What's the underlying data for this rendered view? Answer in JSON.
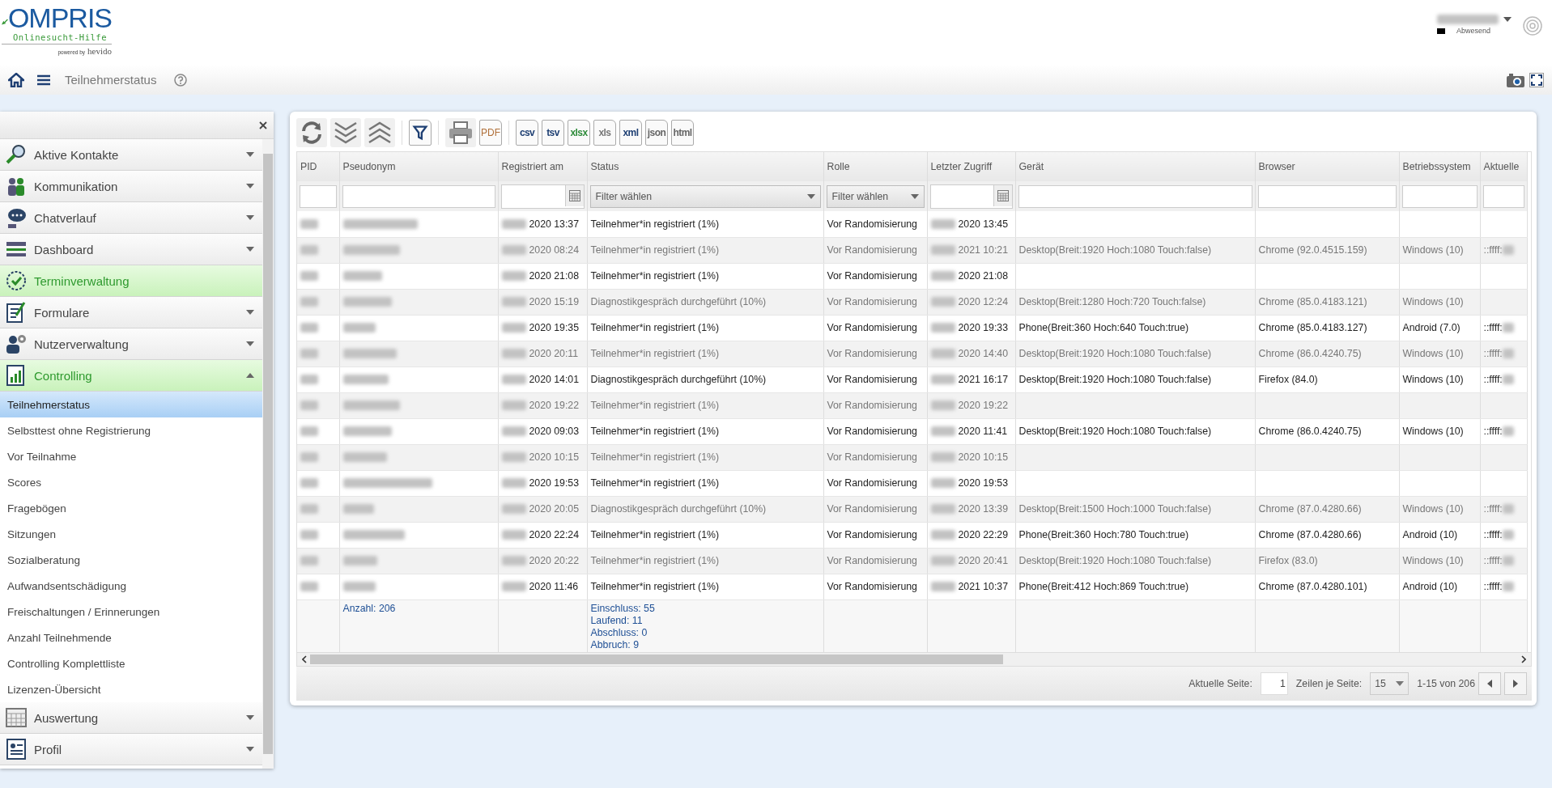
{
  "header": {
    "logo": {
      "title": "OMPRIS",
      "subtitle": "Onlinesucht-Hilfe",
      "powered": "powered by",
      "brand": "hevido"
    },
    "user": {
      "status": "Abwesend"
    }
  },
  "breadcrumb": {
    "title": "Teilnehmerstatus"
  },
  "sidebar": {
    "items": [
      {
        "label": "Aktive Kontakte",
        "kind": "contacts",
        "highlighted": false,
        "expanded": false
      },
      {
        "label": "Kommunikation",
        "kind": "people",
        "highlighted": false,
        "expanded": false
      },
      {
        "label": "Chatverlauf",
        "kind": "chat",
        "highlighted": false,
        "expanded": false
      },
      {
        "label": "Dashboard",
        "kind": "dashboard",
        "highlighted": false,
        "expanded": false
      },
      {
        "label": "Terminverwaltung",
        "kind": "calendar",
        "highlighted": true
      },
      {
        "label": "Formulare",
        "kind": "forms",
        "highlighted": false,
        "expanded": false
      },
      {
        "label": "Nutzerverwaltung",
        "kind": "users",
        "highlighted": false,
        "expanded": false
      },
      {
        "label": "Controlling",
        "kind": "controlling",
        "highlighted": true,
        "expanded": true,
        "children": [
          {
            "label": "Teilnehmerstatus",
            "selected": true
          },
          {
            "label": "Selbsttest ohne Registrierung",
            "selected": false
          },
          {
            "label": "Vor Teilnahme",
            "selected": false
          },
          {
            "label": "Scores",
            "selected": false
          },
          {
            "label": "Fragebögen",
            "selected": false
          },
          {
            "label": "Sitzungen",
            "selected": false
          },
          {
            "label": "Sozialberatung",
            "selected": false
          },
          {
            "label": "Aufwandsentschädigung",
            "selected": false
          },
          {
            "label": "Freischaltungen / Erinnerungen",
            "selected": false
          },
          {
            "label": "Anzahl Teilnehmende",
            "selected": false
          },
          {
            "label": "Controlling Komplettliste",
            "selected": false
          },
          {
            "label": "Lizenzen-Übersicht",
            "selected": false
          }
        ]
      },
      {
        "label": "Auswertung",
        "kind": "evaluation",
        "highlighted": false,
        "expanded": false
      },
      {
        "label": "Profil",
        "kind": "profile",
        "highlighted": false,
        "expanded": false
      }
    ]
  },
  "toolbar": [
    [
      {
        "kind": "refresh"
      },
      {
        "kind": "expand"
      },
      {
        "kind": "collapse"
      }
    ],
    [
      {
        "kind": "filter"
      }
    ],
    [
      {
        "kind": "print"
      },
      {
        "kind": "export",
        "label": "PDF",
        "color": "#b0703a"
      }
    ],
    [
      {
        "kind": "export",
        "label": "csv",
        "color": "#1e3f73"
      },
      {
        "kind": "export",
        "label": "tsv",
        "color": "#1e3f73"
      },
      {
        "kind": "export",
        "label": "xlsx",
        "color": "#2e8b3a"
      },
      {
        "kind": "export",
        "label": "xls",
        "color": "#777777"
      },
      {
        "kind": "export",
        "label": "xml",
        "color": "#1e3f73"
      },
      {
        "kind": "export",
        "label": "json",
        "color": "#666666"
      },
      {
        "kind": "export",
        "label": "html",
        "color": "#666666"
      }
    ]
  ],
  "table": {
    "columns": [
      {
        "label": "PID",
        "kind": "text"
      },
      {
        "label": "Pseudonym",
        "kind": "text"
      },
      {
        "label": "Registriert am",
        "kind": "date"
      },
      {
        "label": "Status",
        "kind": "select",
        "placeholder": "Filter wählen"
      },
      {
        "label": "Rolle",
        "kind": "select",
        "placeholder": "Filter wählen"
      },
      {
        "label": "Letzter Zugriff",
        "kind": "date"
      },
      {
        "label": "Gerät",
        "kind": "text"
      },
      {
        "label": "Browser",
        "kind": "text"
      },
      {
        "label": "Betriebssystem",
        "kind": "text"
      },
      {
        "label": "Aktuelle",
        "kind": "text"
      }
    ],
    "rows": [
      {
        "registered": "2020 13:37",
        "status": "Teilnehmer*in registriert (1%)",
        "role": "Vor Randomisierung",
        "last_access": "2020 13:45"
      },
      {
        "registered": "2020 08:24",
        "status": "Teilnehmer*in registriert (1%)",
        "role": "Vor Randomisierung",
        "last_access": "2021 10:21",
        "device": "Desktop(Breit:1920 Hoch:1080 Touch:false)",
        "browser": "Chrome (92.0.4515.159)",
        "os": "Windows (10)",
        "ip": "::ffff:"
      },
      {
        "registered": "2020 21:08",
        "status": "Teilnehmer*in registriert (1%)",
        "role": "Vor Randomisierung",
        "last_access": "2020 21:08"
      },
      {
        "registered": "2020 15:19",
        "status": "Diagnostikgespräch durchgeführt (10%)",
        "role": "Vor Randomisierung",
        "last_access": "2020 12:24",
        "device": "Desktop(Breit:1280 Hoch:720 Touch:false)",
        "browser": "Chrome (85.0.4183.121)",
        "os": "Windows (10)"
      },
      {
        "registered": "2020 19:35",
        "status": "Teilnehmer*in registriert (1%)",
        "role": "Vor Randomisierung",
        "last_access": "2020 19:33",
        "device": "Phone(Breit:360 Hoch:640 Touch:true)",
        "browser": "Chrome (85.0.4183.127)",
        "os": "Android (7.0)",
        "ip": "::ffff:"
      },
      {
        "registered": "2020 20:11",
        "status": "Teilnehmer*in registriert (1%)",
        "role": "Vor Randomisierung",
        "last_access": "2020 14:40",
        "device": "Desktop(Breit:1920 Hoch:1080 Touch:false)",
        "browser": "Chrome (86.0.4240.75)",
        "os": "Windows (10)",
        "ip": "::ffff:"
      },
      {
        "registered": "2020 14:01",
        "status": "Diagnostikgespräch durchgeführt (10%)",
        "role": "Vor Randomisierung",
        "last_access": "2021 16:17",
        "device": "Desktop(Breit:1920 Hoch:1080 Touch:false)",
        "browser": "Firefox (84.0)",
        "os": "Windows (10)",
        "ip": "::ffff:"
      },
      {
        "registered": "2020 19:22",
        "status": "Teilnehmer*in registriert (1%)",
        "role": "Vor Randomisierung",
        "last_access": "2020 19:22"
      },
      {
        "registered": "2020 09:03",
        "status": "Teilnehmer*in registriert (1%)",
        "role": "Vor Randomisierung",
        "last_access": "2020 11:41",
        "device": "Desktop(Breit:1920 Hoch:1080 Touch:false)",
        "browser": "Chrome (86.0.4240.75)",
        "os": "Windows (10)",
        "ip": "::ffff:"
      },
      {
        "registered": "2020 10:15",
        "status": "Teilnehmer*in registriert (1%)",
        "role": "Vor Randomisierung",
        "last_access": "2020 10:15"
      },
      {
        "registered": "2020 19:53",
        "status": "Teilnehmer*in registriert (1%)",
        "role": "Vor Randomisierung",
        "last_access": "2020 19:53"
      },
      {
        "registered": "2020 20:05",
        "status": "Diagnostikgespräch durchgeführt (10%)",
        "role": "Vor Randomisierung",
        "last_access": "2020 13:39",
        "device": "Desktop(Breit:1500 Hoch:1000 Touch:false)",
        "browser": "Chrome (87.0.4280.66)",
        "os": "Windows (10)",
        "ip": "::ffff:"
      },
      {
        "registered": "2020 22:24",
        "status": "Teilnehmer*in registriert (1%)",
        "role": "Vor Randomisierung",
        "last_access": "2020 22:29",
        "device": "Phone(Breit:360 Hoch:780 Touch:true)",
        "browser": "Chrome (87.0.4280.66)",
        "os": "Android (10)",
        "ip": "::ffff:"
      },
      {
        "registered": "2020 20:22",
        "status": "Teilnehmer*in registriert (1%)",
        "role": "Vor Randomisierung",
        "last_access": "2020 20:41",
        "device": "Desktop(Breit:1920 Hoch:1080 Touch:false)",
        "browser": "Firefox (83.0)",
        "os": "Windows (10)",
        "ip": "::ffff:"
      },
      {
        "registered": "2020 11:46",
        "status": "Teilnehmer*in registriert (1%)",
        "role": "Vor Randomisierung",
        "last_access": "2021 10:37",
        "device": "Phone(Breit:412 Hoch:869 Touch:true)",
        "browser": "Chrome (87.0.4280.101)",
        "os": "Android (10)",
        "ip": "::ffff:"
      }
    ],
    "summary": {
      "count": "Anzahl: 206",
      "status": [
        "Einschluss: 55",
        "Laufend: 11",
        "Abschluss: 0",
        "Abbruch: 9"
      ]
    }
  },
  "pager": {
    "page_label": "Aktuelle Seite:",
    "page": "1",
    "rows_label": "Zeilen je Seite:",
    "rows_per_page": "15",
    "range": "1-15 von 206"
  }
}
